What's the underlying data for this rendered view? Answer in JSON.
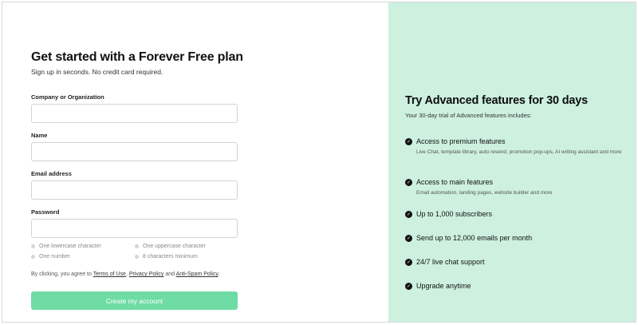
{
  "form": {
    "title": "Get started with a Forever Free plan",
    "subtitle": "Sign up in seconds. No credit card required.",
    "fields": [
      {
        "label": "Company or Organization",
        "value": "",
        "placeholder": ""
      },
      {
        "label": "Name",
        "value": "",
        "placeholder": ""
      },
      {
        "label": "Email address",
        "value": "",
        "placeholder": ""
      },
      {
        "label": "Password",
        "value": "",
        "placeholder": ""
      }
    ],
    "password_requirements": [
      "One lowercase character",
      "One uppercase character",
      "One number",
      "8 characters minimum"
    ],
    "terms": {
      "prefix": "By clicking, you agree to ",
      "terms_link": "Terms of Use",
      "sep1": ", ",
      "privacy_link": "Privacy Policy",
      "sep2": " and ",
      "antispam_link": "Anti-Spam Policy",
      "suffix": "."
    },
    "submit_label": "Create my account"
  },
  "trial": {
    "title": "Try Advanced features for 30 days",
    "subtitle": "Your 30-day trial of Advanced features includes:",
    "features": [
      {
        "title": "Access to premium features",
        "desc": "Live Chat, template library, auto resend, promotion pop-ups, AI writing assistant and more"
      },
      {
        "title": "Access to main features",
        "desc": "Email automation, landing pages, website builder and more"
      },
      {
        "title": "Up to 1,000 subscribers",
        "desc": ""
      },
      {
        "title": "Send up to 12,000 emails per month",
        "desc": ""
      },
      {
        "title": "24/7 live chat support",
        "desc": ""
      },
      {
        "title": "Upgrade anytime",
        "desc": ""
      }
    ]
  },
  "colors": {
    "right_panel_bg": "#cdf0df",
    "button_bg": "#6edca4",
    "button_text": "#ffffff",
    "check_bg": "#111111"
  },
  "icons": {
    "feature_check": "check-circle-icon",
    "requirement_dot": "dot-icon"
  }
}
